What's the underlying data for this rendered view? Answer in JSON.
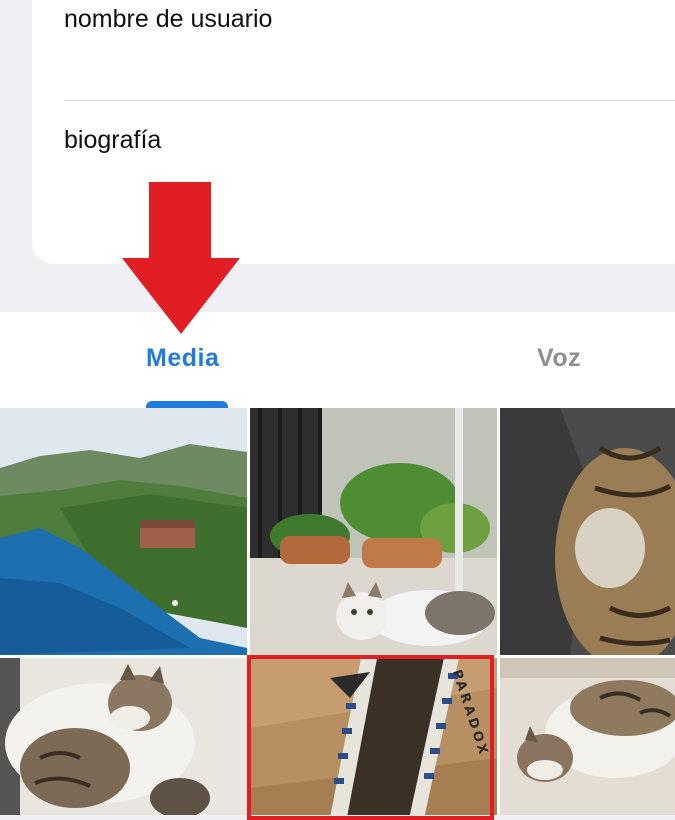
{
  "profile_form": {
    "username_placeholder": "nombre de usuario",
    "bio_placeholder": "biografía"
  },
  "tabs": [
    {
      "label": "Media",
      "selected": true
    },
    {
      "label": "Voz",
      "selected": false
    }
  ],
  "colors": {
    "accent": "#1f7cdc",
    "annotation_arrow": "#e01e24",
    "selection_border": "#e01e24",
    "inactive_tab": "#8e8e93"
  },
  "media_grid": {
    "items": [
      {
        "icon": "landscape-river-photo"
      },
      {
        "icon": "cat-with-plants-photo"
      },
      {
        "icon": "sleeping-cat-closeup-photo"
      },
      {
        "icon": "cat-on-bed-photo"
      },
      {
        "icon": "cardboard-box-photo",
        "selected": true,
        "box_text": "PARADOX"
      },
      {
        "icon": "cat-on-rug-photo"
      }
    ]
  }
}
